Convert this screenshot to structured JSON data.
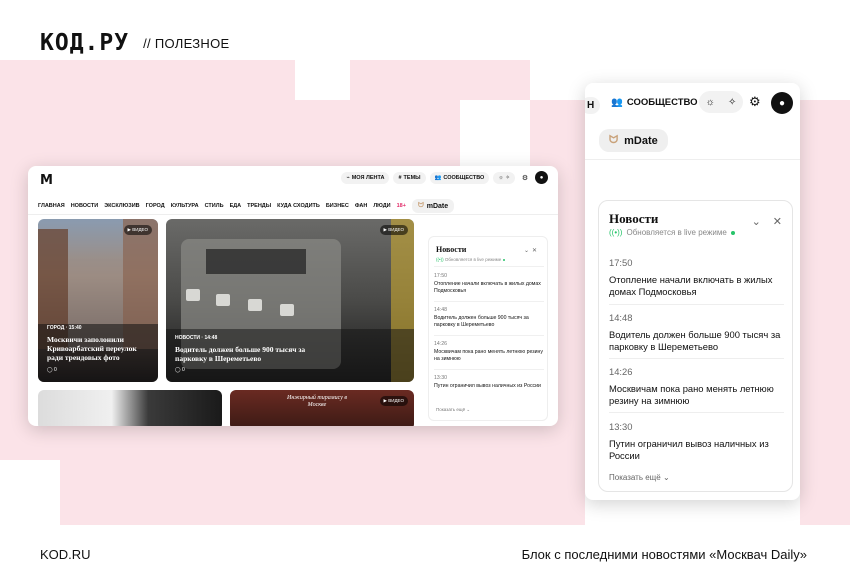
{
  "header": {
    "logo": "КОД.РУ",
    "section": "// ПОЛЕЗНОЕ"
  },
  "footer": {
    "left": "KOD.RU",
    "right": "Блок с последними новостями «Москвач Daily»"
  },
  "site": {
    "logo": "M",
    "top_actions": [
      {
        "icon": "antenna-icon",
        "label": "МОЯ ЛЕНТА"
      },
      {
        "icon": "hash-icon",
        "label": "ТЕМЫ"
      },
      {
        "icon": "people-icon",
        "label": "СООБЩЕСТВО"
      }
    ],
    "nav": [
      "ГЛАВНАЯ",
      "НОВОСТИ",
      "ЭКСКЛЮЗИВ",
      "ГОРОД",
      "КУЛЬТУРА",
      "СТИЛЬ",
      "ЕДА",
      "ТРЕНДЫ",
      "КУДА СХОДИТЬ",
      "БИЗНЕС",
      "ФАН",
      "ЛЮДИ"
    ],
    "nav_age": "18+",
    "mdate": "mDate",
    "cards": [
      {
        "badge": "▶ ВИДЕО",
        "meta": "ГОРОД · 15:40",
        "title": "Москвичи заполонили Кривоарбатский переулок ради трендовых фото",
        "comments": "0"
      },
      {
        "badge": "▶ ВИДЕО",
        "meta": "НОВОСТИ · 14:48",
        "title": "Водитель должен больше 900 тысяч за парковку в Шереметьево",
        "comments": "0"
      },
      {
        "badge": "",
        "meta": "",
        "title": "",
        "comments": ""
      },
      {
        "badge": "▶ ВИДЕО",
        "meta": "",
        "title": "Инжирный тирамису в Москве",
        "comments": ""
      }
    ],
    "news": {
      "title": "Новости",
      "subtitle": "Обновляется в live режиме",
      "items": [
        {
          "time": "17:50",
          "text": "Отопление начали включать в жилых домах Подмосковья"
        },
        {
          "time": "14:48",
          "text": "Водитель должен больше 900 тысяч за парковку в Шереметьево"
        },
        {
          "time": "14:26",
          "text": "Москвичам пока рано менять летнюю резину на зимнюю"
        },
        {
          "time": "13:30",
          "text": "Путин ограничил вывоз наличных из России"
        }
      ],
      "more": "Показать ещё"
    }
  },
  "zoom": {
    "tab_partial": "Н",
    "community": "СООБЩЕСТВО",
    "mdate": "mDate",
    "news_title": "Новости",
    "news_subtitle": "Обновляется в live режиме",
    "items": [
      {
        "time": "17:50",
        "text": "Отопление начали включать в жилых домах Подмосковья"
      },
      {
        "time": "14:48",
        "text": "Водитель должен больше 900 тысяч за парковку в Шереметьево"
      },
      {
        "time": "14:26",
        "text": "Москвичам пока рано менять летнюю резину на зимнюю"
      },
      {
        "time": "13:30",
        "text": "Путин ограничил вывоз наличных из России"
      }
    ],
    "more": "Показать ещё"
  },
  "colors": {
    "bg_blocks": "#fbe3e8",
    "accent_red": "#e2306c",
    "live_green": "#27c46a"
  }
}
